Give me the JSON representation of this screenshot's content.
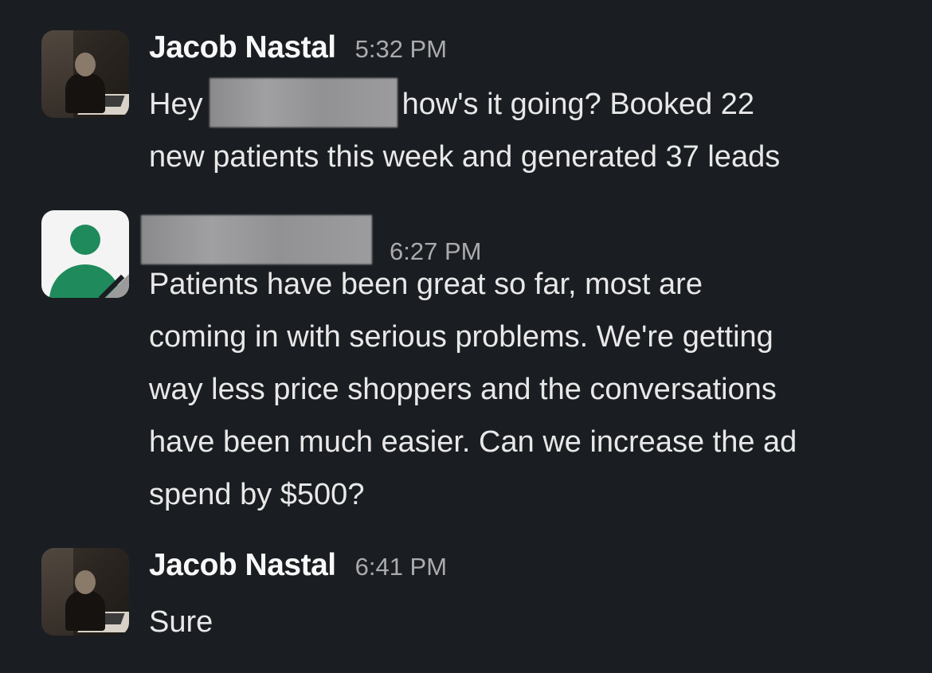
{
  "messages": [
    {
      "author": "Jacob Nastal",
      "time": "5:32 PM",
      "avatar": "user-photo-avatar",
      "text_before": "Hey",
      "text_after": "how's it going? Booked 22",
      "line2": "new patients this week and generated 37 leads"
    },
    {
      "author": "",
      "time": "6:27 PM",
      "avatar": "generic-user-avatar",
      "lines": [
        "Patients have been great so far, most are",
        "coming in with serious problems. We're getting",
        "way less price shoppers and the conversations",
        "have been much easier. Can we increase the ad",
        "spend by $500?"
      ]
    },
    {
      "author": "Jacob Nastal",
      "time": "6:41 PM",
      "avatar": "user-photo-avatar",
      "text": "Sure"
    }
  ],
  "colors": {
    "background": "#1a1d21",
    "name": "#f8f8f8",
    "timestamp": "#ababad",
    "text": "#e8e8e8",
    "avatar_green": "#1f8a5b"
  }
}
